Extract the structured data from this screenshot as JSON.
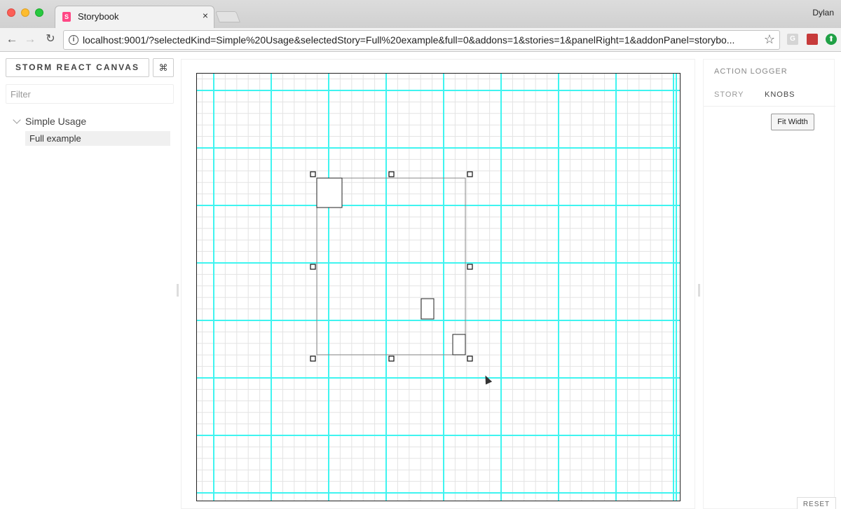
{
  "browser": {
    "tab_title": "Storybook",
    "tab_favicon": "S",
    "tab_close": "×",
    "user_name": "Dylan",
    "url": "localhost:9001/?selectedKind=Simple%20Usage&selectedStory=Full%20example&full=0&addons=1&stories=1&panelRight=1&addonPanel=storybo...",
    "nav": {
      "back": "←",
      "forward": "→",
      "reload": "↻"
    },
    "info_icon": "i",
    "bookmark_icon": "☆",
    "extensions": {
      "g_label": "G",
      "up_label": "⬆"
    }
  },
  "left_panel": {
    "brand_label": "STORM REACT CANVAS",
    "shortcut_label": "⌘",
    "filter_placeholder": "Filter",
    "kind_label": "Simple Usage",
    "story_label": "Full example"
  },
  "addon_panel": {
    "title": "ACTION LOGGER",
    "tabs": [
      "STORY",
      "KNOBS"
    ],
    "fit_width_label": "Fit Width",
    "reset_label": "RESET"
  },
  "colors": {
    "grid_major": "#3ff4f0",
    "grid_minor": "#e3e3e3",
    "selection": "#888888",
    "handle": "#111111"
  },
  "icons": {
    "bookmark": "star-icon",
    "info": "info-icon",
    "shortcut": "command-icon",
    "tree_toggle": "chevron-down-icon"
  }
}
